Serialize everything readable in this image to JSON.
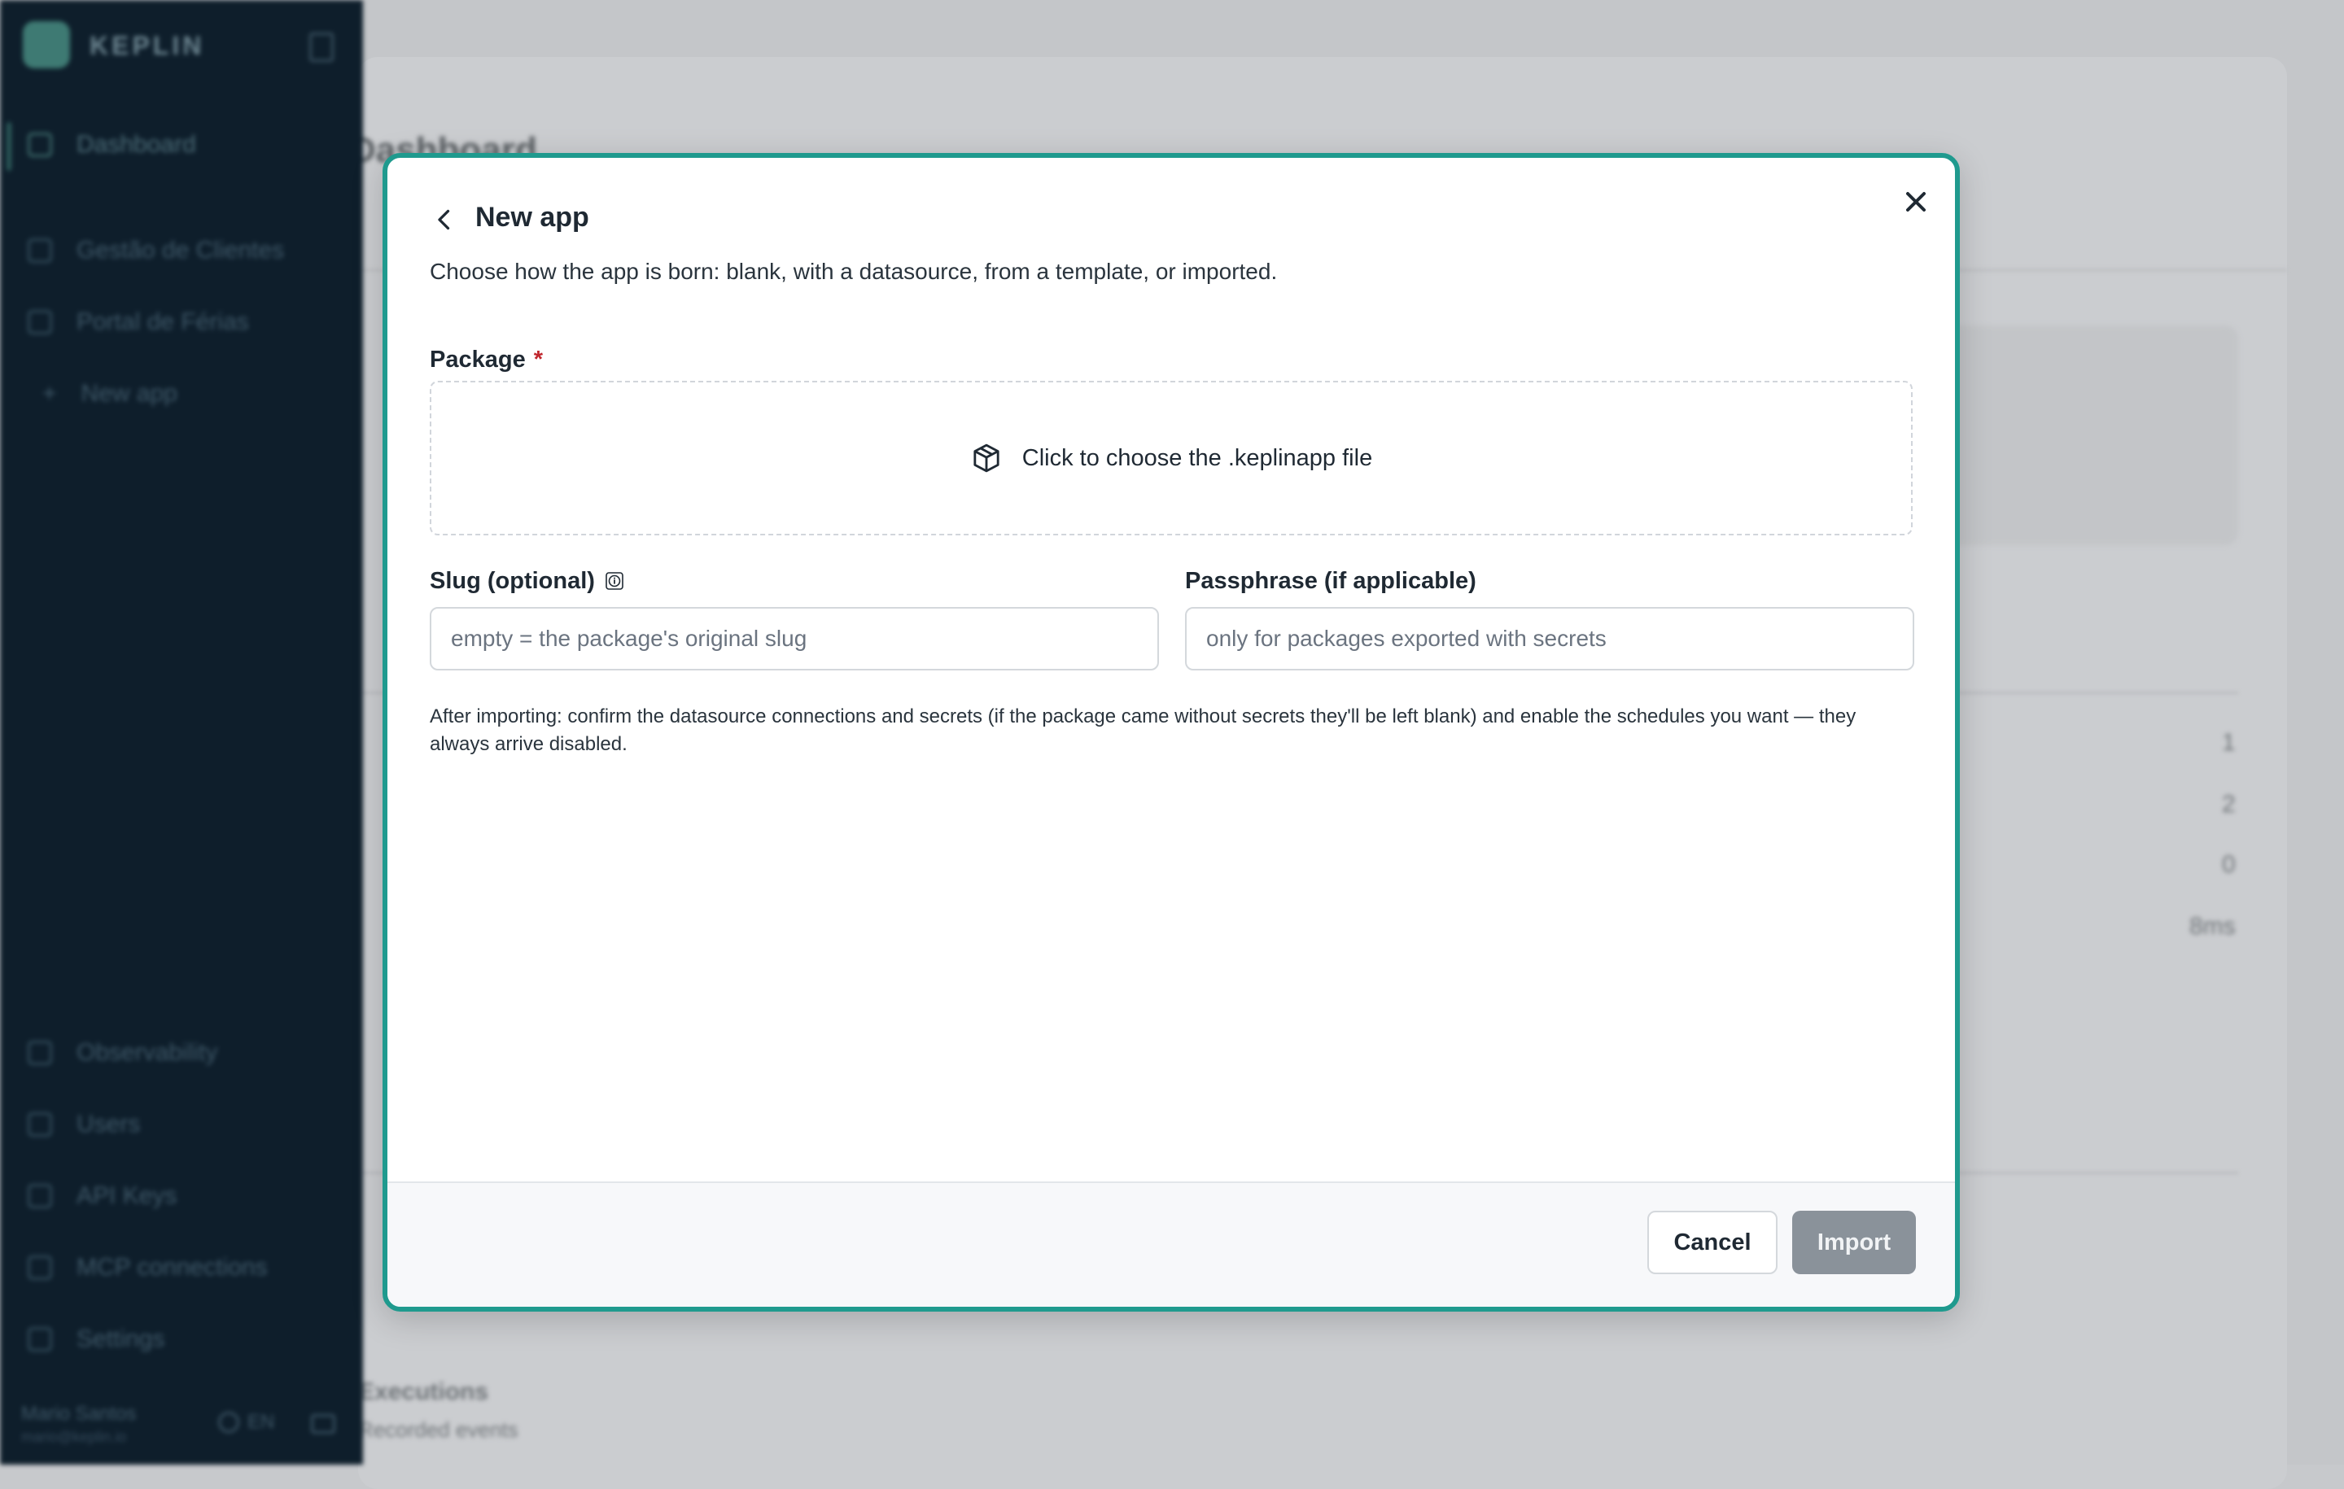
{
  "sidebar": {
    "brand": "KEPLIN",
    "items": [
      {
        "label": "Dashboard"
      },
      {
        "label": "Gestão de Clientes"
      },
      {
        "label": "Portal de Férias"
      },
      {
        "label": "New app"
      }
    ],
    "bottom_items": [
      {
        "label": "Observability"
      },
      {
        "label": "Users"
      },
      {
        "label": "API Keys"
      },
      {
        "label": "MCP connections"
      },
      {
        "label": "Settings"
      }
    ],
    "user_name": "Mario Santos",
    "user_email": "mario@keplin.io",
    "language": "EN"
  },
  "background": {
    "page_title": "Dashboard",
    "row_values": [
      "1",
      "2",
      "0",
      "8ms"
    ],
    "section_title": "Executions",
    "section_sub": "Recorded events"
  },
  "modal": {
    "title": "New app",
    "description": "Choose how the app is born: blank, with a datasource, from a template, or imported.",
    "package": {
      "label": "Package",
      "required_mark": "*",
      "dropzone_text": "Click to choose the .keplinapp file"
    },
    "slug": {
      "label": "Slug (optional)",
      "value": "",
      "placeholder": "empty = the package's original slug"
    },
    "passphrase": {
      "label": "Passphrase (if applicable)",
      "value": "",
      "placeholder": "only for packages exported with secrets"
    },
    "note": "After importing: confirm the datasource connections and secrets (if the package came without secrets they'll be left blank) and enable the schedules you want — they always arrive disabled.",
    "buttons": {
      "cancel": "Cancel",
      "import": "Import"
    }
  },
  "colors": {
    "modal_border": "#1f9a8e",
    "sidebar_bg": "#0e1e2b",
    "import_disabled": "#8a929a",
    "required": "#c0262d"
  },
  "icons": [
    "back-chevron-icon",
    "close-icon",
    "package-box-icon",
    "info-icon"
  ]
}
